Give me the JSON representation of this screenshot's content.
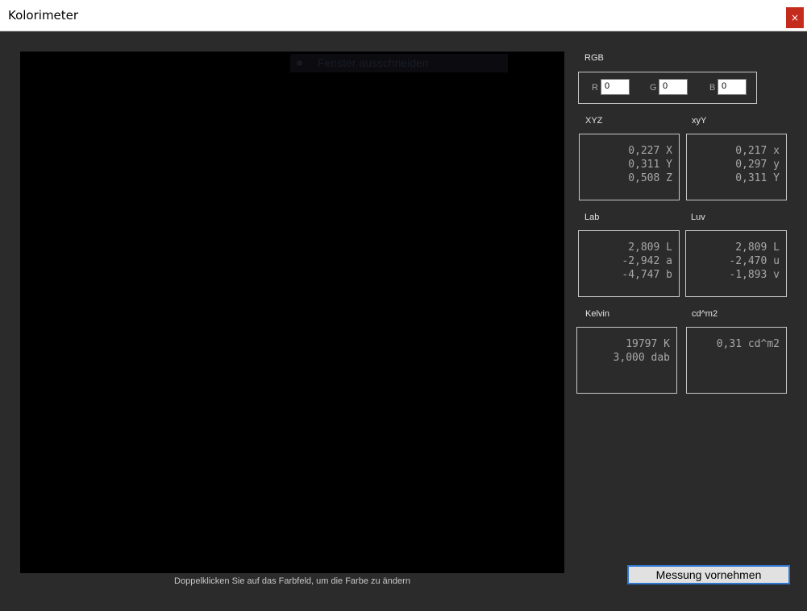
{
  "window": {
    "title": "Kolorimeter",
    "close_glyph": "×"
  },
  "swatch": {
    "color": "#000000",
    "capture_label": "Fenster ausschneiden",
    "hint": "Doppelklicken Sie auf das Farbfeld, um die Farbe zu ändern"
  },
  "rgb": {
    "label": "RGB",
    "r_label": "R",
    "r_value": "0",
    "g_label": "G",
    "g_value": "0",
    "b_label": "B",
    "b_value": "0"
  },
  "xyz": {
    "label": "XYZ",
    "line1": "0,227 X",
    "line2": "0,311 Y",
    "line3": "0,508 Z"
  },
  "xyy": {
    "label": "xyY",
    "line1": "0,217 x",
    "line2": "0,297 y",
    "line3": "0,311 Y"
  },
  "lab": {
    "label": "Lab",
    "line1": "2,809 L",
    "line2": "-2,942 a",
    "line3": "-4,747 b"
  },
  "luv": {
    "label": "Luv",
    "line1": "2,809 L",
    "line2": "-2,470 u",
    "line3": "-1,893 v"
  },
  "kelvin": {
    "label": "Kelvin",
    "line1": "19797 K",
    "line2": "3,000 dab"
  },
  "luminance": {
    "label": "cd^m2",
    "line1": "0,31 cd^m2"
  },
  "actions": {
    "measure_label": "Messung vornehmen"
  }
}
